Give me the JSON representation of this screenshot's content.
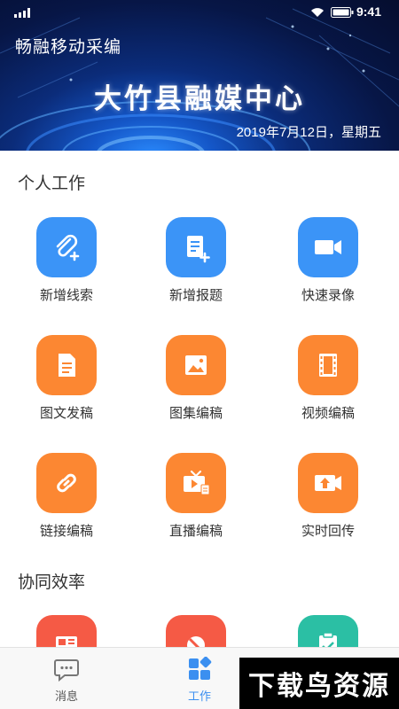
{
  "status_bar": {
    "time": "9:41"
  },
  "header": {
    "app_title": "畅融移动采编",
    "org_title": "大竹县融媒中心",
    "date": "2019年7月12日，星期五"
  },
  "sections": {
    "personal": {
      "title": "个人工作",
      "items": [
        {
          "label": "新增线索",
          "icon": "paperclip-add-icon",
          "color": "#3b94f7"
        },
        {
          "label": "新增报题",
          "icon": "document-add-icon",
          "color": "#3b94f7"
        },
        {
          "label": "快速录像",
          "icon": "video-camera-icon",
          "color": "#3b94f7"
        },
        {
          "label": "图文发稿",
          "icon": "document-icon",
          "color": "#fc8732"
        },
        {
          "label": "图集编稿",
          "icon": "image-icon",
          "color": "#fc8732"
        },
        {
          "label": "视频编稿",
          "icon": "film-icon",
          "color": "#fc8732"
        },
        {
          "label": "链接编稿",
          "icon": "link-icon",
          "color": "#fc8732"
        },
        {
          "label": "直播编稿",
          "icon": "tv-broadcast-icon",
          "color": "#fc8732"
        },
        {
          "label": "实时回传",
          "icon": "camera-upload-icon",
          "color": "#fc8732"
        }
      ]
    },
    "collaboration": {
      "title": "协同效率",
      "items": [
        {
          "icon": "newspaper-icon",
          "color": "#f55a45"
        },
        {
          "icon": "pill-icon",
          "color": "#f55a45"
        },
        {
          "icon": "clipboard-check-icon",
          "color": "#2bbfa4"
        }
      ]
    }
  },
  "bottom_nav": {
    "items": [
      {
        "label": "消息",
        "icon": "message-icon",
        "active": false
      },
      {
        "label": "工作",
        "icon": "grid-icon",
        "active": true
      },
      {
        "label": "",
        "icon": "user-icon",
        "active": false
      }
    ],
    "active_color": "#3b8ff0"
  },
  "watermark": "下载鸟资源"
}
